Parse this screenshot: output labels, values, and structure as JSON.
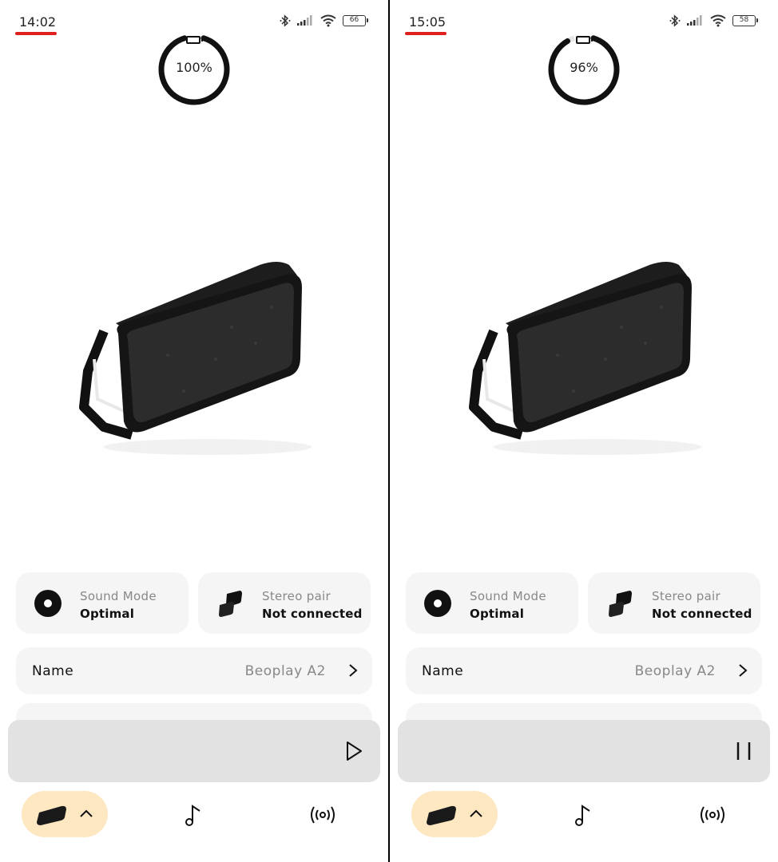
{
  "screens": [
    {
      "id": "left",
      "status_time": "14:02",
      "phone_battery": "66",
      "speaker_battery_label": "100%",
      "speaker_battery_fraction": 1.0,
      "sound_mode": {
        "label": "Sound Mode",
        "value": "Optimal"
      },
      "stereo_pair": {
        "label": "Stereo pair",
        "value": "Not connected"
      },
      "name_row": {
        "label": "Name",
        "value": "Beoplay A2"
      },
      "player_state_icon": "play-icon"
    },
    {
      "id": "right",
      "status_time": "15:05",
      "phone_battery": "58",
      "speaker_battery_label": "96%",
      "speaker_battery_fraction": 0.96,
      "sound_mode": {
        "label": "Sound Mode",
        "value": "Optimal"
      },
      "stereo_pair": {
        "label": "Stereo pair",
        "value": "Not connected"
      },
      "name_row": {
        "label": "Name",
        "value": "Beoplay A2"
      },
      "player_state_icon": "pause-icon"
    }
  ],
  "colors": {
    "accent_underline": "#e0201c",
    "card_bg": "#f5f5f5",
    "player_bg": "#e2e2e2",
    "nav_active_bg": "#fde8c2",
    "ring": "#111111"
  },
  "icons": {
    "status": [
      "bluetooth-icon",
      "signal-icon",
      "wifi-icon",
      "battery-icon"
    ],
    "nav": [
      "speaker-device-icon",
      "chevron-up-icon",
      "music-note-icon",
      "broadcast-icon"
    ]
  }
}
